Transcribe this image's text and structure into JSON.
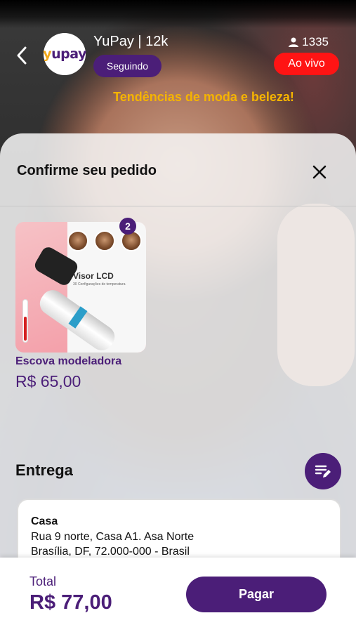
{
  "header": {
    "logo_text": "yupay",
    "channel": "YuPay | 12k",
    "follow_label": "Seguindo",
    "viewer_count": "1335",
    "live_label": "Ao vivo",
    "subtitle": "Tendências de moda e beleza!"
  },
  "sheet": {
    "title": "Confirme seu pedido",
    "product": {
      "image_caption": "Visor LCD",
      "image_subcaption": "30 Configurações de temperatura",
      "quantity": "2",
      "name": "Escova modeladora",
      "price": "R$ 65,00"
    },
    "delivery": {
      "heading": "Entrega",
      "address_title": "Casa",
      "address_line1": "Rua 9 norte, Casa A1. Asa Norte",
      "address_line2": "Brasília, DF, 72.000-000 - Brasil"
    }
  },
  "footer": {
    "total_label": "Total",
    "total_value": "R$ 77,00",
    "pay_label": "Pagar"
  },
  "colors": {
    "brand_purple": "#4b1e78",
    "live_red": "#ff1414",
    "accent_yellow": "#f5b400"
  },
  "icons": [
    "back-arrow-icon",
    "user-icon",
    "close-icon",
    "edit-list-icon"
  ]
}
